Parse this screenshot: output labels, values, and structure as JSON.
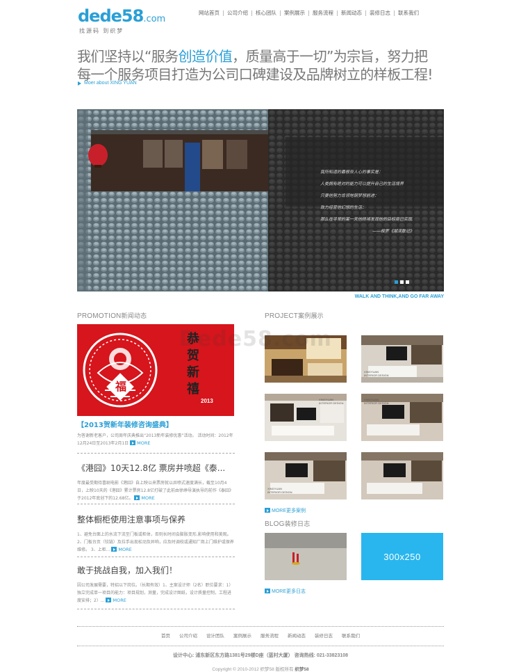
{
  "logo": {
    "main": "dede58",
    "suffix": ".com",
    "slogan": "找源码 到织梦"
  },
  "nav": [
    "网站首页",
    "公司介绍",
    "核心团队",
    "案例展示",
    "服务流程",
    "新闻动态",
    "装修日志",
    "联系我们"
  ],
  "hero": {
    "line1_before": "我们坚持以“服务",
    "line1_highlight": "创造价值",
    "line1_after": "，质量高于一切”为宗旨，努力把",
    "line2": "每一个服务项目打造为公司口碑建设及品牌树立的样板工程!",
    "more": "Moer about XING YUAN"
  },
  "banner": {
    "poem": [
      "我所知道的最根奈人心的事实是：",
      "人类拥有绝对的能力可以提升自己的生活境界",
      "只要他努力肯领地钢梦想前进：",
      "致力经营他幻想的生活：",
      "那么在寻常的某一天他终将发现他的目标竟已实现."
    ],
    "signature": "——梭罗《湖滨散记》",
    "caption": "WALK AND THINK,AND GO FAR AWAY",
    "colors": {
      "accent": "#2a9fd6"
    }
  },
  "promotion": {
    "title_en": "PROMOTION",
    "title_zh": "新闻动态",
    "image_text": {
      "vertical": "恭贺新禧",
      "year": "2013",
      "fu": "福"
    },
    "items": [
      {
        "title": "【2013贺新年装修咨询盛典】",
        "desc": "为答谢新老客户，公司周年庆典推出“2013新年装修优惠”活动。 活动时间：2012年12月24日至2013年2月1日",
        "more": "MORE"
      },
      {
        "title": "《港囧》10天12.8亿 票房井喷超《泰...",
        "desc": "年度最受期待喜剧电影《港囧》自上映以来票房就以井喷式速度满长，截至10月4日，上映10天的《港囧》累计票房12.8亿打破了此前由徐峥导演执导的前作《泰囧》于2012年底创下的12.68亿。",
        "more": "MORE"
      },
      {
        "title": "整体橱柜使用注意事项与保养",
        "desc": "1、避免台面上的水流下流至门板或柜体，否则长时间会膨胀变形,影响使用和美观。 2、门板台页（铰链）及拉手出现松动及异响，应及时调校或通知厂商上门维护或保养维修。 3、上柜...",
        "more": "MORE"
      },
      {
        "title": "敢于挑战自我，加入我们！",
        "desc": "因公司发展需要，特招以下岗位。（长期有效）1、主案设计师（2名）职位要求：1）独立完成单一项目的能力：项目规划，测量，完成设计图纸，设计质量控制，工程进度安排；2）...",
        "more": "MORE"
      }
    ]
  },
  "project": {
    "title_en": "PROJECT",
    "title_zh": "案例展示",
    "thumb_label": [
      "XINGYUAN",
      "INTERIOR DESIGN"
    ],
    "more": "MORE更多案例"
  },
  "blog": {
    "title_en": "BLOG",
    "title_zh": "装修日志",
    "ad_text": "300x250",
    "more": "MORE更多日志"
  },
  "watermark": "Dede58.com",
  "footer": {
    "nav": [
      "首页",
      "公司介绍",
      "设计团队",
      "案例展示",
      "服务流程",
      "新闻动态",
      "装修日志",
      "联系我们"
    ],
    "contact": "设计中心: 浦东新区东方路1381号29楼D座（蓝村大厦） 咨询热线: 021-33823108",
    "copyright_prefix": "Copyright © 2010-2012 织梦58 版权所有 ",
    "copyright_brand": "织梦58"
  }
}
